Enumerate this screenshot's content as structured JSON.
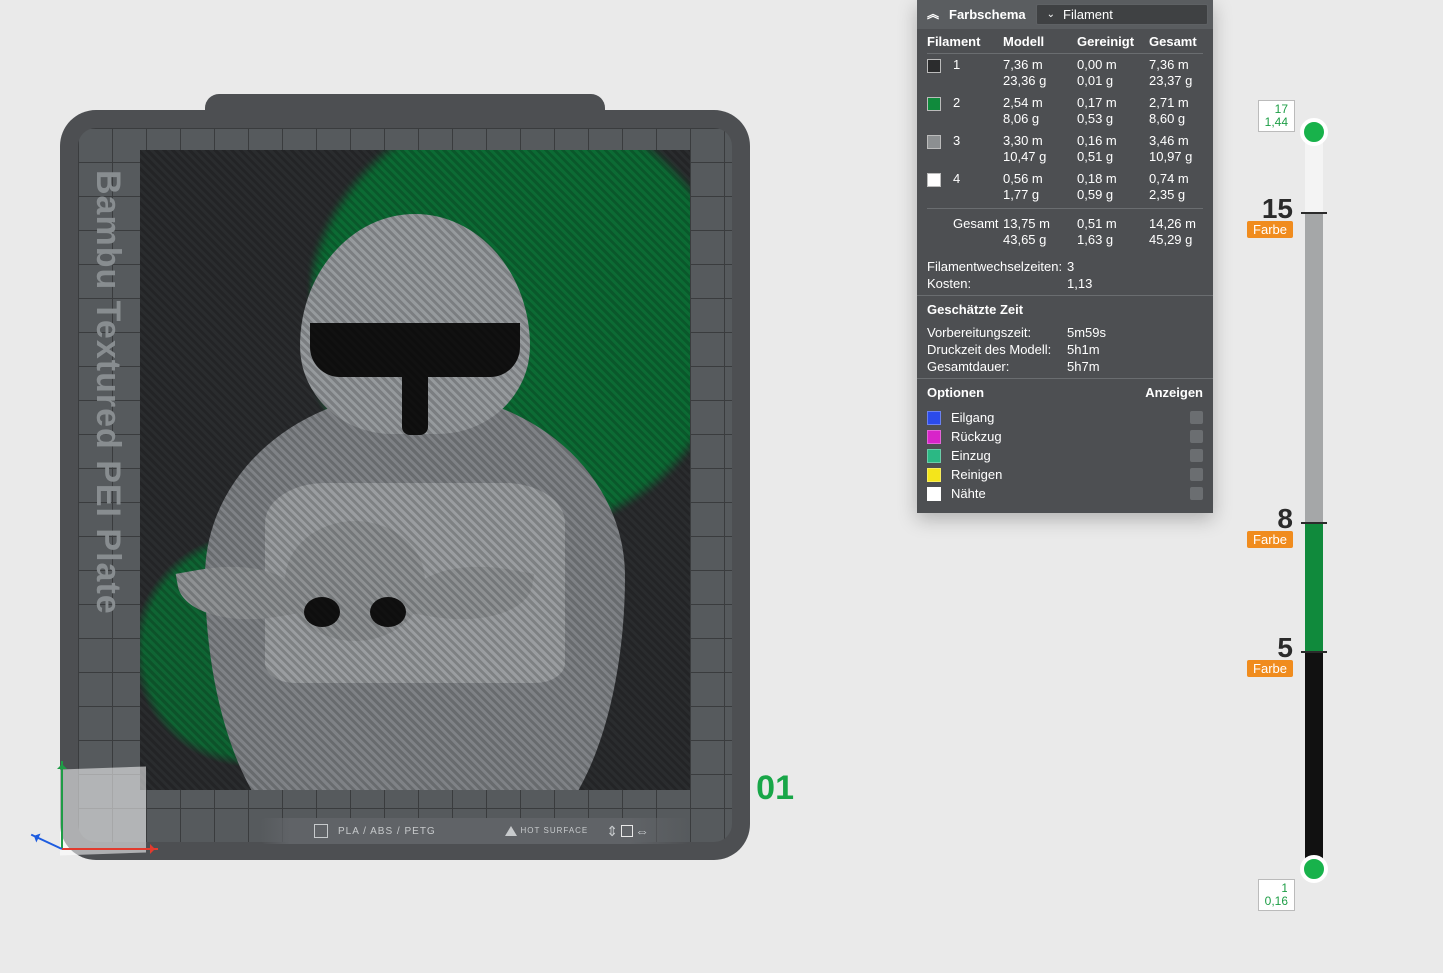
{
  "plate": {
    "label": "Bambu Textured PEI Plate",
    "material_text": "PLA / ABS / PETG",
    "hot_surface": "HOT SURFACE",
    "number": "01"
  },
  "panel": {
    "title": "Farbschema",
    "select_value": "Filament",
    "table": {
      "headers": {
        "filament": "Filament",
        "model": "Modell",
        "purged": "Gereinigt",
        "total": "Gesamt"
      },
      "rows": [
        {
          "swatch": "#2B2C2D",
          "idx": "1",
          "model_m": "7,36 m",
          "model_g": "23,36 g",
          "purge_m": "0,00 m",
          "purge_g": "0,01 g",
          "total_m": "7,36 m",
          "total_g": "23,37 g"
        },
        {
          "swatch": "#108A3C",
          "idx": "2",
          "model_m": "2,54 m",
          "model_g": "8,06 g",
          "purge_m": "0,17 m",
          "purge_g": "0,53 g",
          "total_m": "2,71 m",
          "total_g": "8,60 g"
        },
        {
          "swatch": "#8C8F91",
          "idx": "3",
          "model_m": "3,30 m",
          "model_g": "10,47 g",
          "purge_m": "0,16 m",
          "purge_g": "0,51 g",
          "total_m": "3,46 m",
          "total_g": "10,97 g"
        },
        {
          "swatch": "#FFFFFF",
          "idx": "4",
          "model_m": "0,56 m",
          "model_g": "1,77 g",
          "purge_m": "0,18 m",
          "purge_g": "0,59 g",
          "total_m": "0,74 m",
          "total_g": "2,35 g"
        }
      ],
      "sum": {
        "label": "Gesamt",
        "model_m": "13,75 m",
        "model_g": "43,65 g",
        "purge_m": "0,51 m",
        "purge_g": "1,63 g",
        "total_m": "14,26 m",
        "total_g": "45,29 g"
      }
    },
    "fil_changes_label": "Filamentwechselzeiten:",
    "fil_changes_value": "3",
    "cost_label": "Kosten:",
    "cost_value": "1,13",
    "time_section": "Geschätzte Zeit",
    "time": {
      "prep_label": "Vorbereitungszeit:",
      "prep_value": "5m59s",
      "print_label": "Druckzeit des Modell:",
      "print_value": "5h1m",
      "total_label": "Gesamtdauer:",
      "total_value": "5h7m"
    },
    "options_label": "Optionen",
    "show_label": "Anzeigen",
    "options": [
      {
        "color": "#2B4BEA",
        "label": "Eilgang"
      },
      {
        "color": "#D824C9",
        "label": "Rückzug"
      },
      {
        "color": "#2BB884",
        "label": "Einzug"
      },
      {
        "color": "#F4E51B",
        "label": "Reinigen"
      },
      {
        "color": "#FFFFFF",
        "label": "Nähte"
      }
    ]
  },
  "layers": {
    "top_tag_layer": "17",
    "top_tag_height": "1,44",
    "bottom_tag_layer": "1",
    "bottom_tag_height": "0,16",
    "badge": "Farbe",
    "marks": [
      {
        "layer": "15",
        "pct_from_top": 11
      },
      {
        "layer": "8",
        "pct_from_top": 53
      },
      {
        "layer": "5",
        "pct_from_top": 70.5
      }
    ],
    "segments": [
      {
        "color": "#F4F4F4",
        "from": 0,
        "to": 11
      },
      {
        "color": "#A5A7A8",
        "from": 11,
        "to": 53
      },
      {
        "color": "#108A3C",
        "from": 53,
        "to": 70.5
      },
      {
        "color": "#111111",
        "from": 70.5,
        "to": 100
      }
    ]
  }
}
